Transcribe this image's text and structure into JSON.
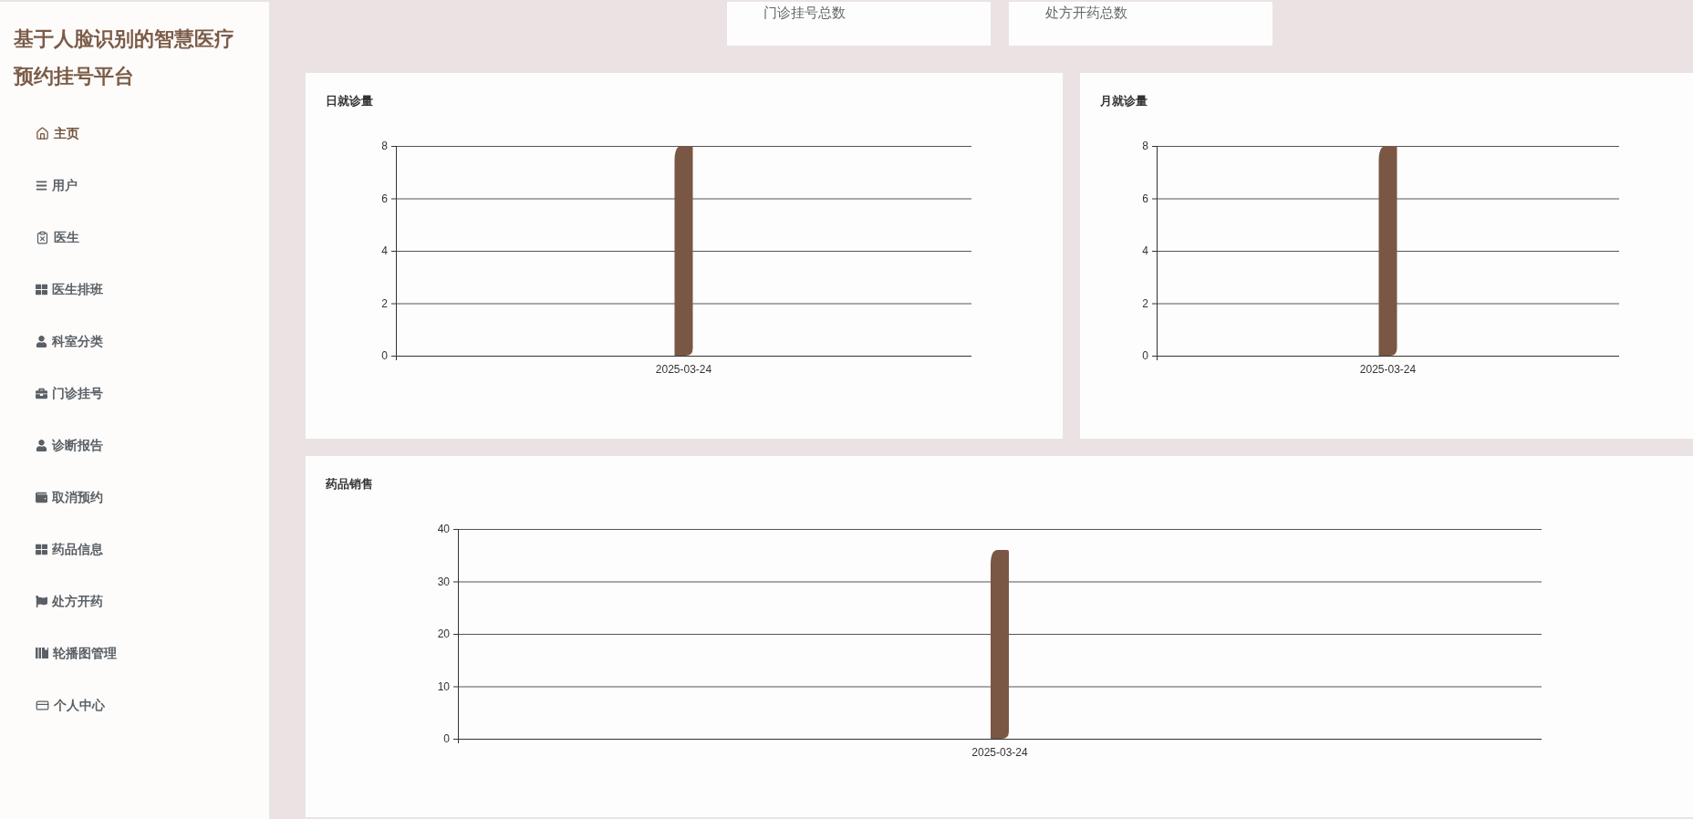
{
  "sidebar": {
    "title": "基于人脸识别的智慧医疗预约挂号平台",
    "menu": [
      {
        "label": "主页",
        "selected": true
      },
      {
        "label": "用户",
        "selected": false
      },
      {
        "label": "医生",
        "selected": false
      },
      {
        "label": "医生排班",
        "selected": false
      },
      {
        "label": "科室分类",
        "selected": false
      },
      {
        "label": "门诊挂号",
        "selected": false
      },
      {
        "label": "诊断报告",
        "selected": false
      },
      {
        "label": "取消预约",
        "selected": false
      },
      {
        "label": "药品信息",
        "selected": false
      },
      {
        "label": "处方开药",
        "selected": false
      },
      {
        "label": "轮播图管理",
        "selected": false
      },
      {
        "label": "个人中心",
        "selected": false
      }
    ]
  },
  "stat_cards": [
    {
      "label": "门诊挂号总数"
    },
    {
      "label": "处方开药总数"
    }
  ],
  "charts": [
    {
      "chart_data": {
        "type": "bar",
        "title": "日就诊量",
        "categories": [
          "2025-03-24"
        ],
        "series": [
          {
            "color": "#7a5644",
            "values": [
              8
            ]
          }
        ],
        "ylim": [
          0,
          8
        ],
        "yticks": [
          0,
          2,
          4,
          6,
          8
        ],
        "grid": true
      }
    },
    {
      "chart_data": {
        "type": "bar",
        "title": "月就诊量",
        "categories": [
          "2025-03-24"
        ],
        "series": [
          {
            "color": "#7a5644",
            "values": [
              8
            ]
          }
        ],
        "ylim": [
          0,
          8
        ],
        "yticks": [
          0,
          2,
          4,
          6,
          8
        ],
        "grid": true
      }
    },
    {
      "chart_data": {
        "type": "bar",
        "title": "药品销售",
        "categories": [
          "2025-03-24"
        ],
        "series": [
          {
            "color": "#7a5644",
            "values": [
              36
            ]
          }
        ],
        "ylim": [
          0,
          40
        ],
        "yticks": [
          0,
          10,
          20,
          30,
          40
        ],
        "grid": true
      }
    }
  ]
}
